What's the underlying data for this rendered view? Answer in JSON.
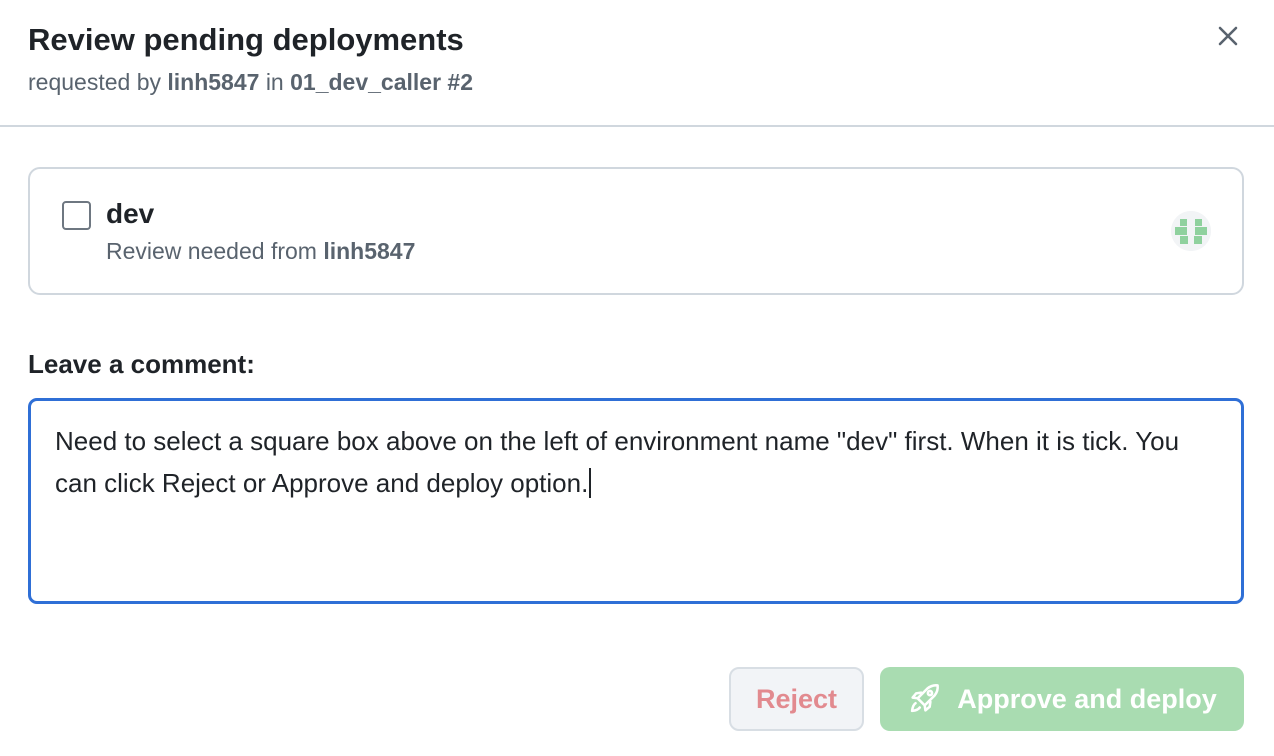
{
  "dialog": {
    "title": "Review pending deployments",
    "subtitle": {
      "prefix": "requested by",
      "user": "linh5847",
      "middle": "in",
      "workflow": "01_dev_caller #2"
    },
    "close_icon": "close-icon"
  },
  "environment": {
    "name": "dev",
    "checked": false,
    "review_prefix": "Review needed from",
    "reviewer": "linh5847",
    "avatar_icon": "identicon-avatar"
  },
  "comment": {
    "label": "Leave a comment:",
    "value": "Need to select a square box above on the left of environment name \"dev\" first. When it is tick. You can click Reject or Approve and deploy option."
  },
  "actions": {
    "reject_label": "Reject",
    "approve_label": "Approve and deploy",
    "approve_icon": "rocket-icon",
    "disabled": true
  },
  "colors": {
    "focus_border": "#2f6fd6",
    "approve_disabled_bg": "#a9dcb1",
    "reject_disabled_text": "#e28a8f",
    "muted_text": "#59636e",
    "border": "#d0d7de"
  }
}
